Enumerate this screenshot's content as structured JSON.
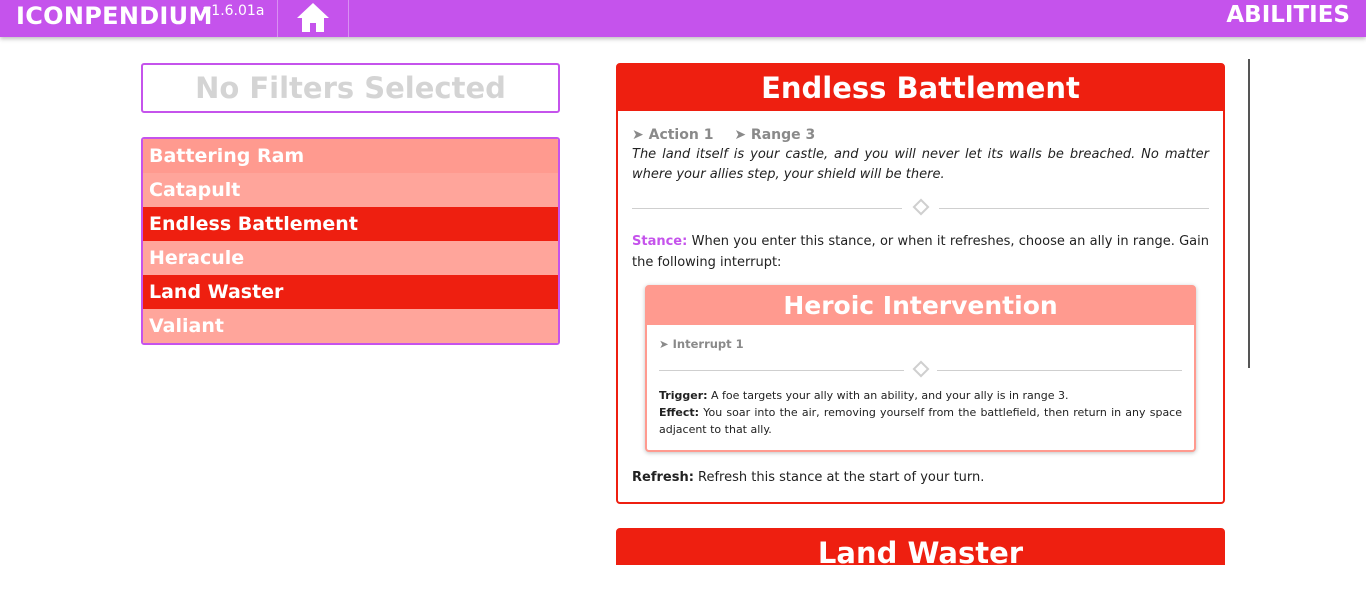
{
  "app": {
    "brand": "ICONPENDIUM",
    "version": "v1.6.01a",
    "section": "ABILITIES",
    "home_icon": "home-icon",
    "accent_color": "#c553ec"
  },
  "filters": {
    "status": "No Filters Selected"
  },
  "abilities": [
    {
      "label": "Battering Ram",
      "selected": false
    },
    {
      "label": "Catapult",
      "selected": false
    },
    {
      "label": "Endless Battlement",
      "selected": true
    },
    {
      "label": "Heracule",
      "selected": false
    },
    {
      "label": "Land Waster",
      "selected": true
    },
    {
      "label": "Valiant",
      "selected": false
    }
  ],
  "detail": {
    "title": "Endless Battlement",
    "action_tag": "➤ Action 1",
    "range_tag": "➤ Range 3",
    "flavor": "The land itself is your castle, and you will never let its walls be breached. No matter where your allies step, your shield will be there.",
    "stance_keyword": "Stance:",
    "stance_text": " When you enter this stance, or when it refreshes, choose an ally in range. Gain the following interrupt:",
    "interrupt": {
      "title": "Heroic Intervention",
      "tag": "➤ Interrupt 1",
      "trigger_label": "Trigger:",
      "trigger_text": " A foe targets your ally with an ability, and your ally is in range 3.",
      "effect_label": "Effect:",
      "effect_text": " You soar into the air, removing yourself from the battlefield, then return in any space adjacent to that ally."
    },
    "refresh_label": "Refresh:",
    "refresh_text": " Refresh this stance at the start of your turn."
  },
  "next_card": {
    "title": "Land Waster"
  },
  "colors": {
    "primary_red": "#ee1f10",
    "light_red": "#ff9a8f"
  }
}
